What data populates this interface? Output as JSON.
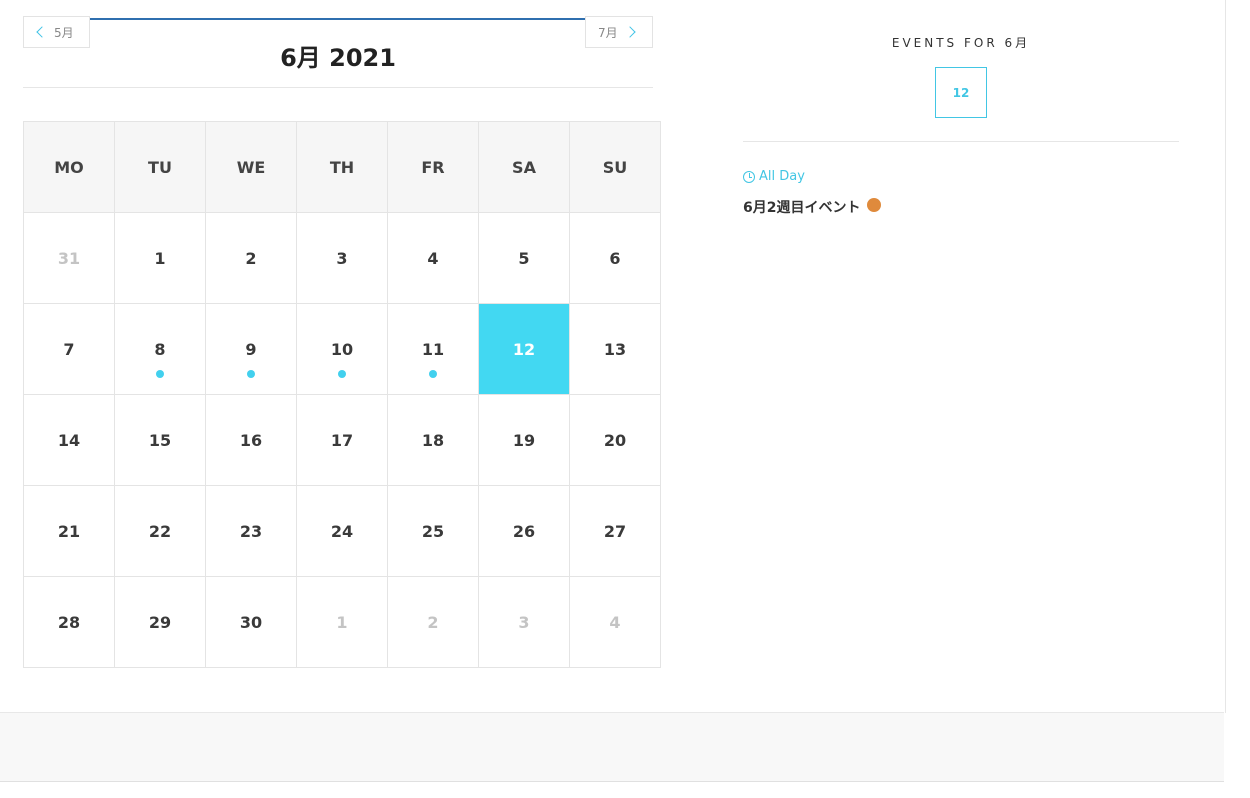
{
  "calendar": {
    "title": "6月 2021",
    "prev_label": "5月",
    "next_label": "7月",
    "weekdays": [
      "MO",
      "TU",
      "WE",
      "TH",
      "FR",
      "SA",
      "SU"
    ],
    "weeks": [
      [
        {
          "day": "31",
          "other": true
        },
        {
          "day": "1"
        },
        {
          "day": "2"
        },
        {
          "day": "3"
        },
        {
          "day": "4"
        },
        {
          "day": "5"
        },
        {
          "day": "6"
        }
      ],
      [
        {
          "day": "7"
        },
        {
          "day": "8",
          "event": true
        },
        {
          "day": "9",
          "event": true
        },
        {
          "day": "10",
          "event": true
        },
        {
          "day": "11",
          "event": true
        },
        {
          "day": "12",
          "today": true
        },
        {
          "day": "13"
        }
      ],
      [
        {
          "day": "14"
        },
        {
          "day": "15"
        },
        {
          "day": "16"
        },
        {
          "day": "17"
        },
        {
          "day": "18"
        },
        {
          "day": "19"
        },
        {
          "day": "20"
        }
      ],
      [
        {
          "day": "21"
        },
        {
          "day": "22"
        },
        {
          "day": "23"
        },
        {
          "day": "24"
        },
        {
          "day": "25"
        },
        {
          "day": "26"
        },
        {
          "day": "27"
        }
      ],
      [
        {
          "day": "28"
        },
        {
          "day": "29"
        },
        {
          "day": "30"
        },
        {
          "day": "1",
          "other": true
        },
        {
          "day": "2",
          "other": true
        },
        {
          "day": "3",
          "other": true
        },
        {
          "day": "4",
          "other": true
        }
      ]
    ]
  },
  "events": {
    "heading": "EVENTS FOR 6月",
    "selected_day": "12",
    "items": [
      {
        "time": "All Day",
        "title": "6月2週目イベント",
        "color": "#df8a3c"
      }
    ]
  },
  "colors": {
    "accent": "#42d8f2",
    "nav_line": "#2f6faf",
    "event_dot": "#42d0ee"
  },
  "icons": {
    "prev": "chevron-left-icon",
    "next": "chevron-right-icon",
    "time": "clock-icon"
  }
}
